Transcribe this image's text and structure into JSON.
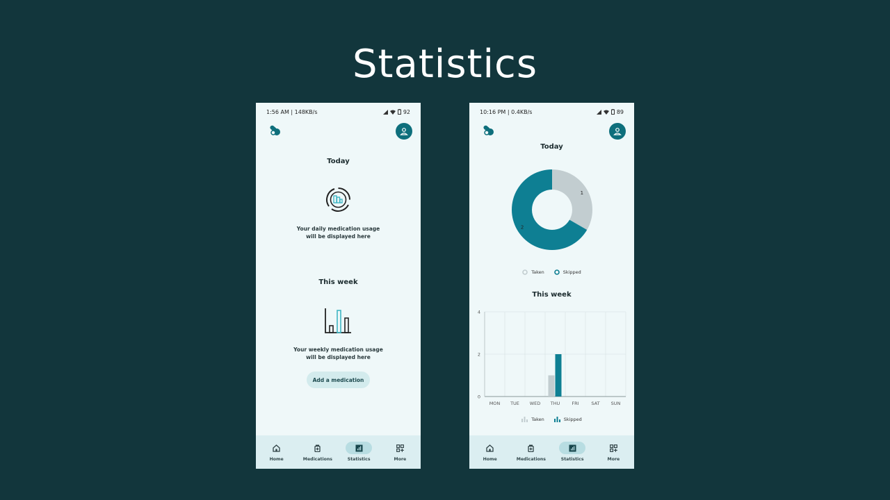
{
  "slide": {
    "title": "Statistics"
  },
  "colors": {
    "background": "#12363c",
    "primary": "#0e7f93",
    "taken": "#c2cdd0",
    "screen": "#eff8f9"
  },
  "phone_left": {
    "status": {
      "left": "1:56 AM | 148KB/s",
      "battery": "92"
    },
    "today_title": "Today",
    "today_empty_line1": "Your daily medication usage",
    "today_empty_line2": "will be displayed here",
    "week_title": "This week",
    "week_empty_line1": "Your weekly medication usage",
    "week_empty_line2": "will be displayed here",
    "add_button": "Add a medication"
  },
  "phone_right": {
    "status": {
      "left": "10:16 PM | 0.4KB/s",
      "battery": "89"
    },
    "today_title": "Today",
    "week_title": "This week",
    "donut_legend": {
      "taken": "Taken",
      "skipped": "Skipped"
    },
    "bar_legend": {
      "taken": "Taken",
      "skipped": "Skipped"
    }
  },
  "nav": [
    "Home",
    "Medications",
    "Statistics",
    "More"
  ],
  "nav_active": "Statistics",
  "icons": [
    "pill-logo-icon",
    "user-icon",
    "home-icon",
    "medication-box-icon",
    "bar-chart-icon",
    "grid-add-icon"
  ],
  "chart_data": [
    {
      "type": "pie",
      "variant": "donut",
      "title": "Today",
      "categories": [
        "Taken",
        "Skipped"
      ],
      "values": [
        1,
        2
      ],
      "labels": [
        "1",
        "2"
      ],
      "colors": [
        "#c2cdd0",
        "#0e7f93"
      ]
    },
    {
      "type": "bar",
      "title": "This week",
      "categories": [
        "MON",
        "TUE",
        "WED",
        "THU",
        "FRI",
        "SAT",
        "SUN"
      ],
      "series": [
        {
          "name": "Taken",
          "values": [
            0,
            0,
            0,
            1,
            0,
            0,
            0
          ]
        },
        {
          "name": "Skipped",
          "values": [
            0,
            0,
            0,
            2,
            0,
            0,
            0
          ]
        }
      ],
      "ylim": [
        0,
        4
      ],
      "yticks": [
        "0",
        "2",
        "4"
      ],
      "grid": true,
      "legend": "bottom"
    }
  ]
}
